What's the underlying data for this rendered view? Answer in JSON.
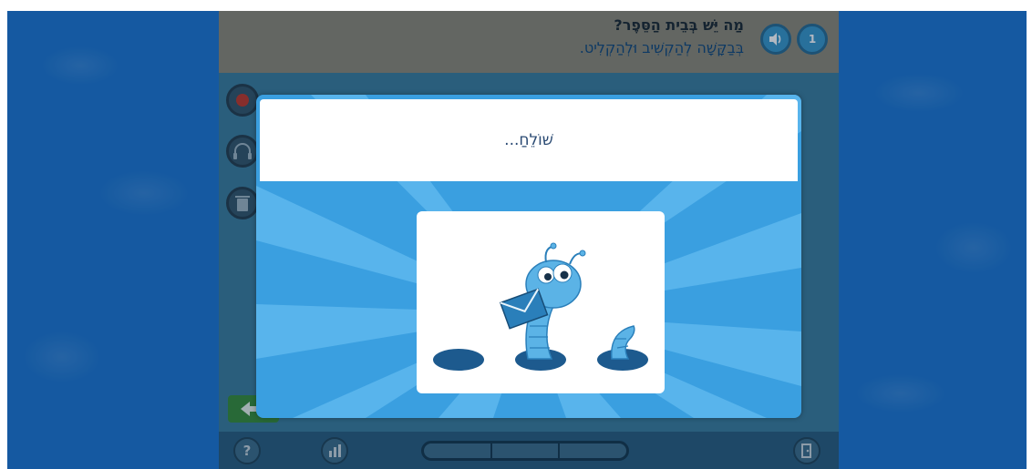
{
  "header": {
    "question_number": "1",
    "title": "מַה יֵּשׁ בְּבֵית הַסֵּפֶר?",
    "instruction": "בְּבַקָּשָׁה לְהַקְשִׁיב וּלְהַקְלִיט."
  },
  "footer": {
    "help_label": "?"
  },
  "modal": {
    "status_text": "שׁוֹלֵחַ..."
  },
  "icons": {
    "number_badge": "number-badge",
    "speaker": "speaker-icon",
    "record": "record-icon",
    "listen": "headphones-icon",
    "delete": "trash-icon",
    "back": "back-arrow-icon",
    "help": "help-icon",
    "stats": "stats-icon",
    "exit": "exit-icon",
    "worm": "worm-with-envelope-illustration"
  },
  "colors": {
    "page_background": "#1f78d1",
    "modal_background": "#3a9fe0",
    "header_background": "#8f8a78",
    "footer_background": "#2c5f7e",
    "title_text": "#2a4a73"
  },
  "progress": {
    "segments": 3,
    "completed": 0
  }
}
